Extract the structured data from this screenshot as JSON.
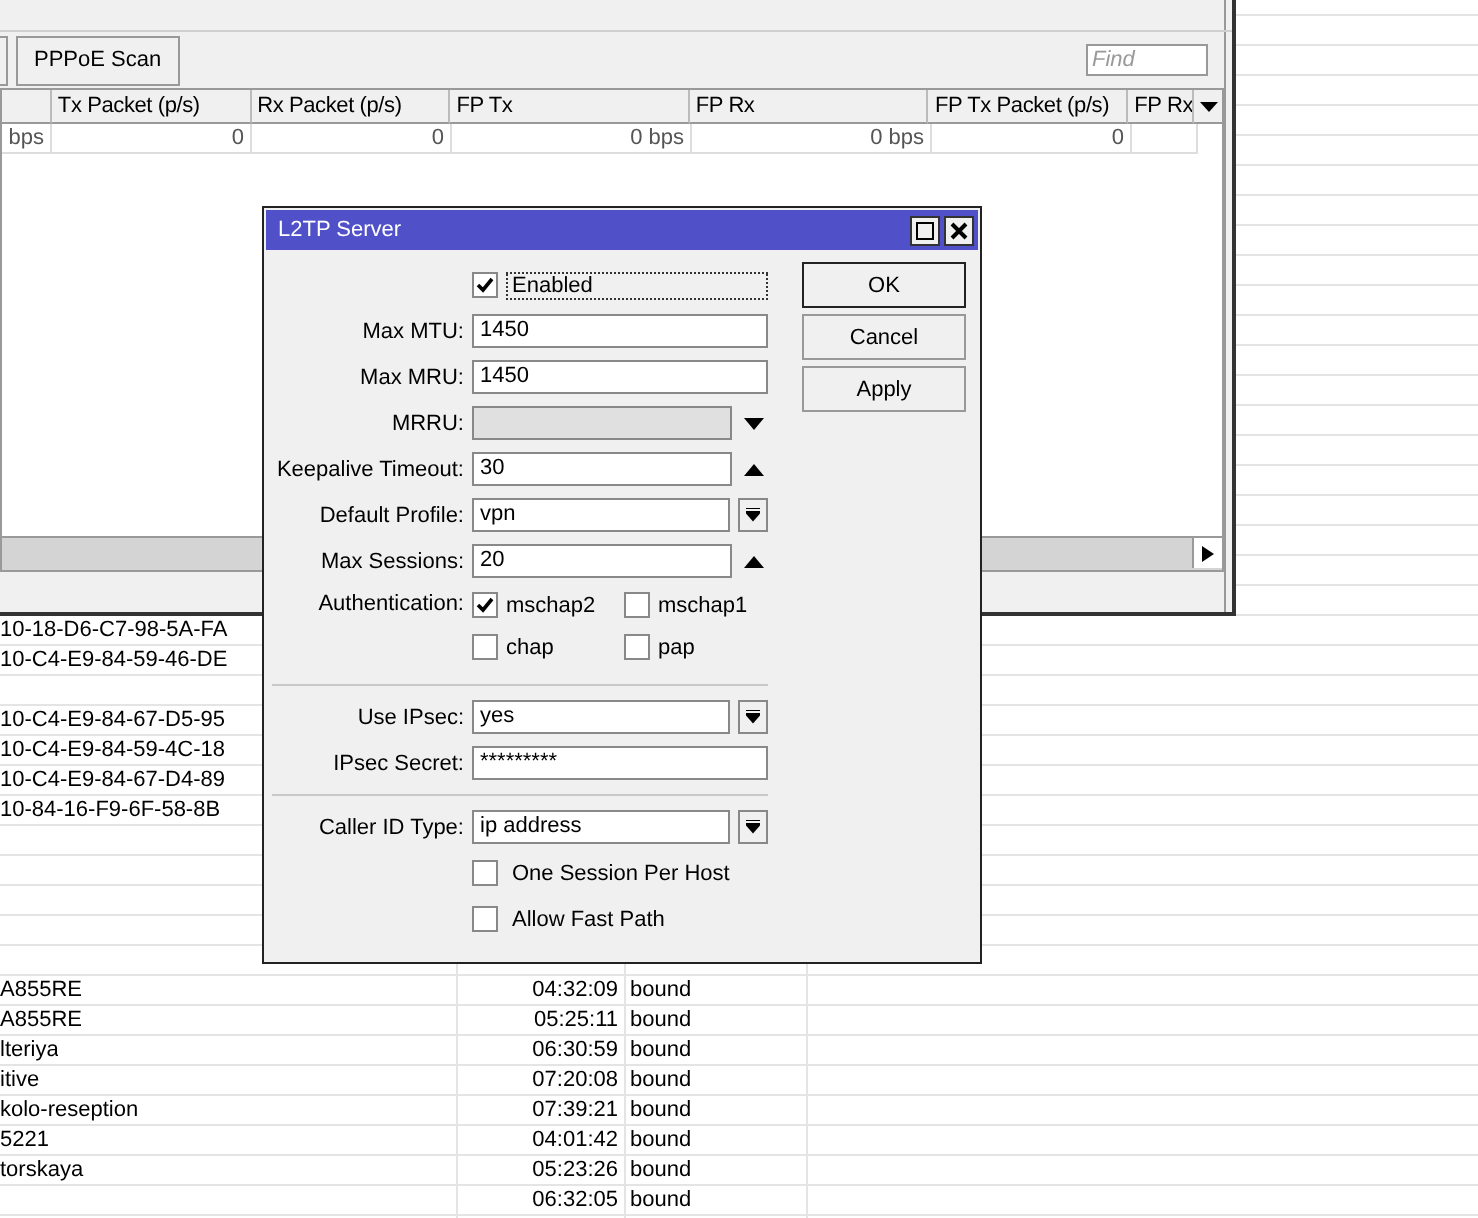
{
  "background_list": {
    "upper_rows": [
      {
        "name": "10-18-D6-C7-98-5A-FA"
      },
      {
        "name": "10-C4-E9-84-59-46-DE"
      },
      {},
      {
        "name": "10-C4-E9-84-67-D5-95"
      },
      {
        "name": "10-C4-E9-84-59-4C-18"
      },
      {
        "name": "10-C4-E9-84-67-D4-89"
      },
      {
        "name": "10-84-16-F9-6F-58-8B"
      }
    ],
    "lower_rows": [
      {
        "name": "A855RE",
        "uptime": "04:32:09",
        "status": "bound"
      },
      {
        "name": "A855RE",
        "uptime": "05:25:11",
        "status": "bound"
      },
      {
        "name": "lteriya",
        "uptime": "06:30:59",
        "status": "bound"
      },
      {
        "name": "itive",
        "uptime": "07:20:08",
        "status": "bound"
      },
      {
        "name": "kolo-reseption",
        "uptime": "07:39:21",
        "status": "bound"
      },
      {
        "name": "5221",
        "uptime": "04:01:42",
        "status": "bound"
      },
      {
        "name": "torskaya",
        "uptime": "05:23:26",
        "status": "bound"
      },
      {
        "uptime": "06:32:05",
        "status": "bound"
      }
    ]
  },
  "interface_window": {
    "toolbar": {
      "button": "PPPoE Scan",
      "find_placeholder": "Find"
    },
    "table": {
      "columns": [
        "",
        "Tx Packet (p/s)",
        "Rx Packet (p/s)",
        "FP Tx",
        "FP Rx",
        "FP Tx Packet (p/s)",
        "FP Rx"
      ],
      "rows": [
        [
          "bps",
          "0",
          "0",
          "0 bps",
          "0 bps",
          "0",
          ""
        ]
      ]
    }
  },
  "dialog": {
    "title": "L2TP Server",
    "fields": [
      {
        "kind": "checkbox",
        "label": "Enabled",
        "checked": true,
        "focused": true
      },
      {
        "kind": "field",
        "label": "Max MTU:",
        "value": "1450"
      },
      {
        "kind": "field",
        "label": "Max MRU:",
        "value": "1450"
      },
      {
        "kind": "field",
        "label": "MRRU:",
        "disabled": true,
        "button": {
          "kind": "down"
        }
      },
      {
        "kind": "field",
        "label": "Keepalive Timeout:",
        "value": "30",
        "button": {
          "kind": "up"
        }
      },
      {
        "kind": "field",
        "label": "Default Profile:",
        "value": "vpn",
        "button": {
          "kind": "dropdown"
        }
      },
      {
        "kind": "field",
        "label": "Max Sessions:",
        "value": "20",
        "button": {
          "kind": "up"
        }
      },
      {
        "kind": "checks",
        "label": "Authentication:",
        "options": [
          {
            "label": "mschap2",
            "checked": true
          },
          {
            "label": "mschap1",
            "checked": false
          },
          {
            "label": "chap",
            "checked": false
          },
          {
            "label": "pap",
            "checked": false
          }
        ]
      },
      {
        "kind": "separator"
      },
      {
        "kind": "field",
        "label": "Use IPsec:",
        "value": "yes",
        "button": {
          "kind": "dropdown"
        }
      },
      {
        "kind": "field",
        "label": "IPsec Secret:",
        "value": "*********"
      },
      {
        "kind": "separator"
      },
      {
        "kind": "field",
        "label": "Caller ID Type:",
        "value": "ip address",
        "button": {
          "kind": "dropdown"
        }
      },
      {
        "kind": "checkbox",
        "label": "One Session Per Host",
        "checked": false,
        "focused": false
      },
      {
        "kind": "checkbox",
        "label": "Allow Fast Path",
        "checked": false,
        "focused": false
      }
    ],
    "buttons": [
      {
        "label": "OK",
        "default": true
      },
      {
        "label": "Cancel",
        "default": false
      },
      {
        "label": "Apply",
        "default": false
      }
    ]
  }
}
